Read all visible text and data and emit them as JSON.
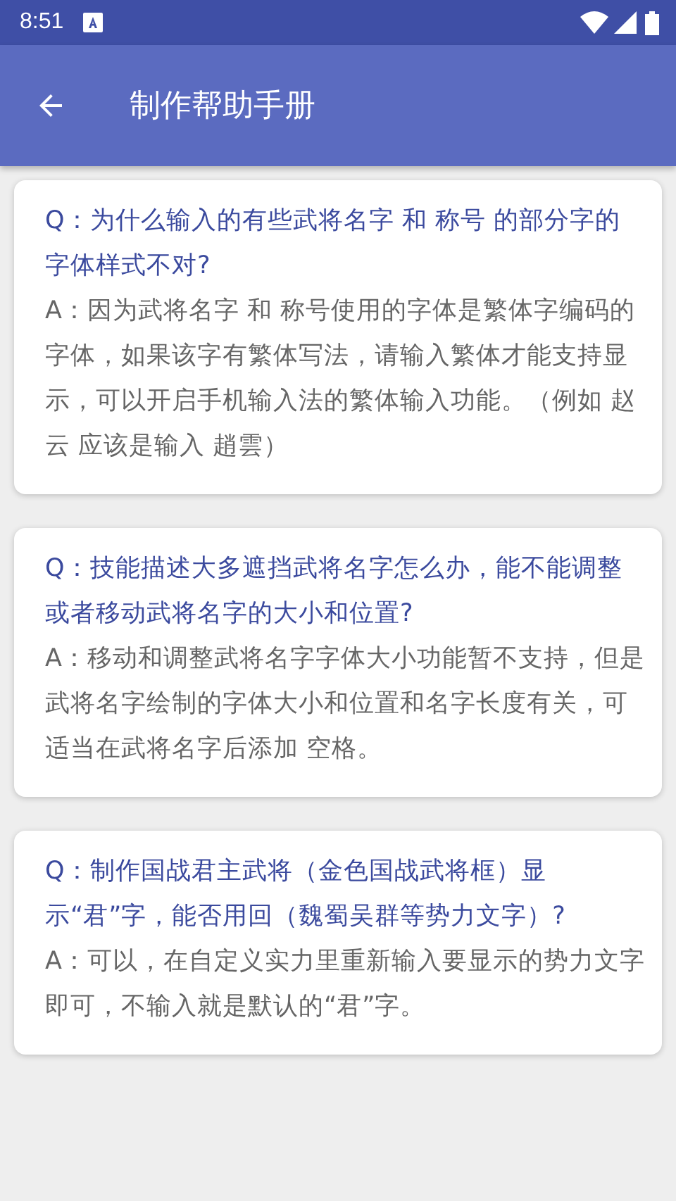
{
  "status_bar": {
    "time": "8:51"
  },
  "app_bar": {
    "title": "制作帮助手册"
  },
  "faq": [
    {
      "question": "Q：为什么输入的有些武将名字 和 称号 的部分字的字体样式不对?",
      "answer": "A：因为武将名字 和 称号使用的字体是繁体字编码的字体，如果该字有繁体写法，请输入繁体才能支持显示，可以开启手机输入法的繁体输入功能。（例如 赵云 应该是输入 趙雲）"
    },
    {
      "question": "Q：技能描述大多遮挡武将名字怎么办，能不能调整或者移动武将名字的大小和位置?",
      "answer": "A：移动和调整武将名字字体大小功能暂不支持，但是武将名字绘制的字体大小和位置和名字长度有关，可适当在武将名字后添加 空格。"
    },
    {
      "question": "Q：制作国战君主武将（金色国战武将框）显示“君”字，能否用回（魏蜀吴群等势力文字）?",
      "answer": "A：可以，在自定义实力里重新输入要显示的势力文字即可，不输入就是默认的“君”字。"
    }
  ]
}
